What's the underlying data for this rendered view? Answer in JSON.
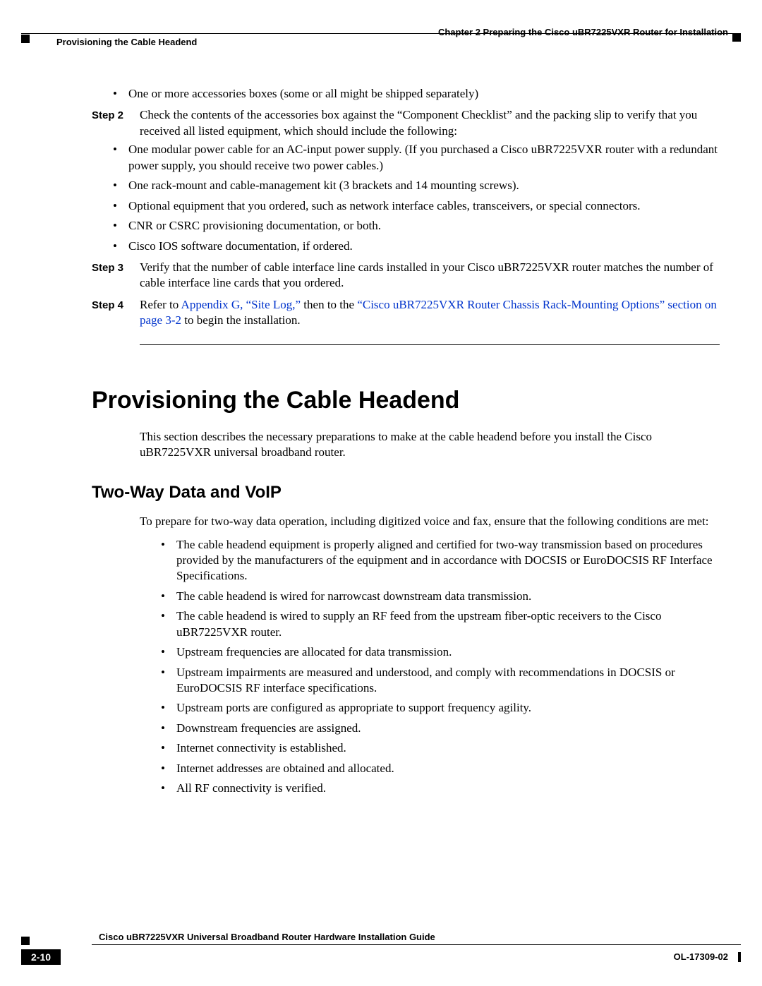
{
  "header": {
    "chapter": "Chapter 2      Preparing the Cisco uBR7225VXR Router for Installation",
    "section": "Provisioning the Cable Headend"
  },
  "top_bullet": "One or more accessories boxes (some or all might be shipped separately)",
  "steps": {
    "s2": {
      "label": "Step 2",
      "text": "Check the contents of the accessories box against the “Component Checklist” and the packing slip to verify that you received all listed equipment, which should include the following:",
      "bullets": [
        "One modular power cable for an AC-input power supply. (If you purchased a Cisco uBR7225VXR router with a redundant power supply, you should receive two power cables.)",
        "One rack-mount and cable-management kit (3 brackets and 14 mounting screws).",
        "Optional equipment that you ordered, such as network interface cables, transceivers, or special connectors.",
        "CNR or CSRC provisioning documentation, or both.",
        "Cisco IOS software documentation, if ordered."
      ]
    },
    "s3": {
      "label": "Step 3",
      "text": "Verify that the number of cable interface line cards installed in your Cisco uBR7225VXR router matches the number of cable interface line cards that you ordered."
    },
    "s4": {
      "label": "Step 4",
      "pre": "Refer to ",
      "link1": "Appendix G, “Site Log,”",
      "mid": " then to the ",
      "link2": "“Cisco uBR7225VXR Router Chassis Rack-Mounting Options” section on page 3-2",
      "post": " to begin the installation."
    }
  },
  "h1": "Provisioning the Cable Headend",
  "intro": "This section describes the necessary preparations to make at the cable headend before you install the Cisco uBR7225VXR universal broadband router.",
  "h2": "Two-Way Data and VoIP",
  "sub_intro": "To prepare for two-way data operation, including digitized voice and fax, ensure that the following conditions are met:",
  "sub_bullets": [
    "The cable headend equipment is properly aligned and certified for two-way transmission based on procedures provided by the manufacturers of the equipment and in accordance with DOCSIS or EuroDOCSIS RF Interface Specifications.",
    "The cable headend is wired for narrowcast downstream data transmission.",
    "The cable headend is wired to supply an RF feed from the upstream fiber-optic receivers to the Cisco uBR7225VXR router.",
    "Upstream frequencies are allocated for data transmission.",
    "Upstream impairments are measured and understood, and comply with recommendations in DOCSIS or EuroDOCSIS RF interface specifications.",
    "Upstream ports are configured as appropriate to support frequency agility.",
    "Downstream frequencies are assigned.",
    "Internet connectivity is established.",
    "Internet addresses are obtained and allocated.",
    "All RF connectivity is verified."
  ],
  "footer": {
    "guide": "Cisco uBR7225VXR Universal Broadband Router Hardware Installation Guide",
    "page": "2-10",
    "doc": "OL-17309-02"
  }
}
